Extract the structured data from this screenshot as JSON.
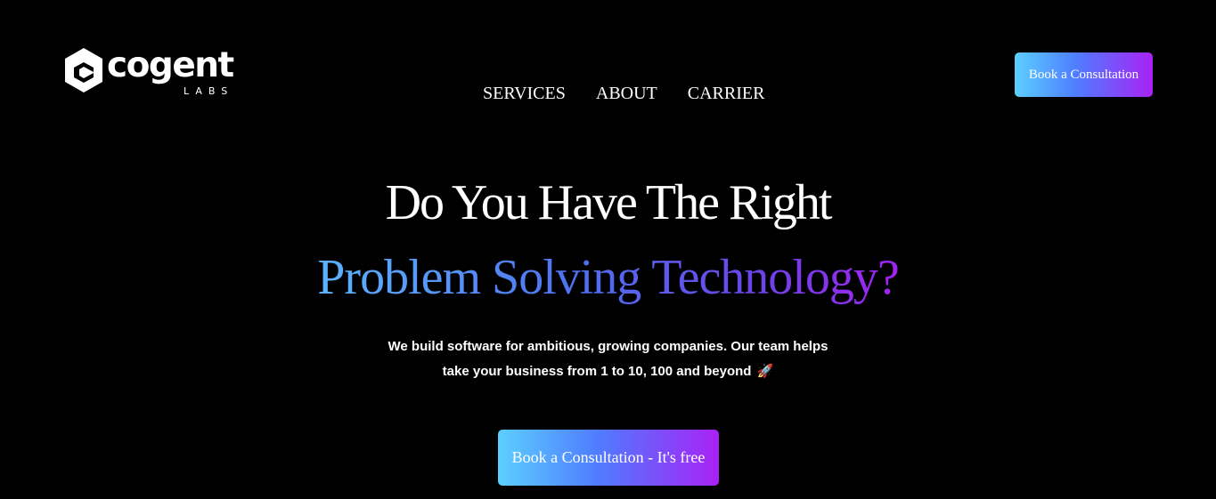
{
  "brand": {
    "name": "cogent",
    "sub": "LABS",
    "logo_icon": "hexagon-cube-icon",
    "accent_start": "#5ccfff",
    "accent_mid": "#4f7cff",
    "accent_end": "#a822f5"
  },
  "nav": {
    "items": [
      {
        "label": "SERVICES"
      },
      {
        "label": "ABOUT"
      },
      {
        "label": "CARRIER"
      }
    ]
  },
  "header": {
    "cta_label": "Book a Consultation"
  },
  "hero": {
    "title": "Do You Have The Right",
    "subtitle": "Problem Solving Technology?",
    "desc_line1": "We build software for ambitious, growing companies. Our team helps",
    "desc_line2": "take your business from 1 to 10, 100 and beyond",
    "rocket_icon": "🚀",
    "cta_label": "Book a Consultation - It's free"
  }
}
